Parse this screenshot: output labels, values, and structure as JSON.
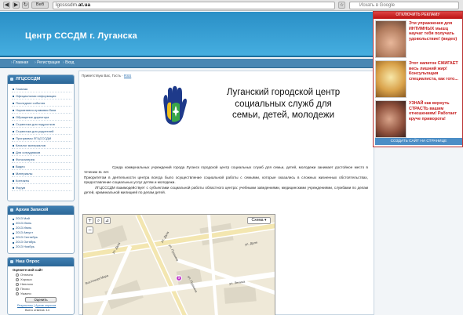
{
  "browser": {
    "back": "◀",
    "forward": "▶",
    "reload": "↻",
    "url_prefix": "lgcsssdm.",
    "url_domain": "at.ua",
    "search_placeholder": "Искать в Google",
    "title_tag": "Веб"
  },
  "site": {
    "title": "Центр СССДМ г. Луганска",
    "nav": [
      "Главная",
      "Регистрация",
      "Вход"
    ]
  },
  "sidebar": {
    "menu_title": "ЛГЦСССДМ",
    "menu_items": [
      "Главная",
      "Официальная информация",
      "Последние события",
      "Нормативно-правовая база",
      "Обращение директора",
      "Страничка для подростков",
      "Страничка для родителей",
      "Программы ЛГЦСССДМ",
      "Каталог материалов",
      "Для сотрудников",
      "Фотогалерея",
      "Видео",
      "Материалы",
      "Контакты",
      "Форум"
    ],
    "archive_title": "Архив Записей",
    "archive_items": [
      "2013 Май",
      "2013 Июнь",
      "2013 Июль",
      "2013 Август",
      "2013 Сентябрь",
      "2013 Октябрь",
      "2013 Ноябрь"
    ],
    "poll_title": "Наш Опрос",
    "poll_question": "Оцените мой сайт",
    "poll_options": [
      "Отлично",
      "Хорошо",
      "Неплохо",
      "Плохо",
      "Ужасно"
    ],
    "poll_button": "Оценить",
    "poll_results": "Результаты",
    "poll_archive": "Архив опросов",
    "poll_total": "Всего ответов: 14"
  },
  "content": {
    "greeting_prefix": "Приветствую Вас, Гость · ",
    "greeting_link": "RSS",
    "org_line1": "Луганский городской центр",
    "org_line2": "социальных служб для",
    "org_line3": "семьи, детей, молодежи",
    "para1": "Среда коммунальных учреждений города Луганск городской центр социальных служб для семьи, детей, молодежи занимает достойное место в течении 11 лет.",
    "para2": "Приоритетом в деятельности центра всегда было осуществление социальной работы с семьями, которые оказались в сложных жизненных обстоятельствах, предоставление социальных услуг детям и молодежи.",
    "para3": "ЛГЦСССДМ взаимодействует с субъектами социальной работы областного центра: учебными заведениями, медицинскими учреждениями, службами по делам детей, криминальной милицией по делам детей.",
    "map_type": "Схема",
    "streets": [
      "ул. Даля",
      "ул. Даля",
      "ул. Даля",
      "ул. Пушкина",
      "ул. Пушкина",
      "Восточная Мира",
      "ул. Ленина"
    ],
    "map_marker": "9"
  },
  "ads": {
    "header": "ОТКЛЮЧИТЬ РЕКЛАМУ",
    "items": [
      "Эти упражнения для ИНТИМНЫХ мышц научат тебя получать удовольствие! (видео)",
      "Этот напиток СЖИГАЕТ весь лишний жир! Консультация специалиста, как гото...",
      "УЗНАЙ как вернуть СТРАСТЬ вашим отношениям! Работает круче приворота!"
    ],
    "footer": "СОЗДАТЬ САЙТ НА СТРАНИЦЕ"
  },
  "colors": {
    "header": "#2a8fc6",
    "nav": "#4a87b3",
    "ad_text": "#c41818",
    "box_head": "#2c6797"
  }
}
